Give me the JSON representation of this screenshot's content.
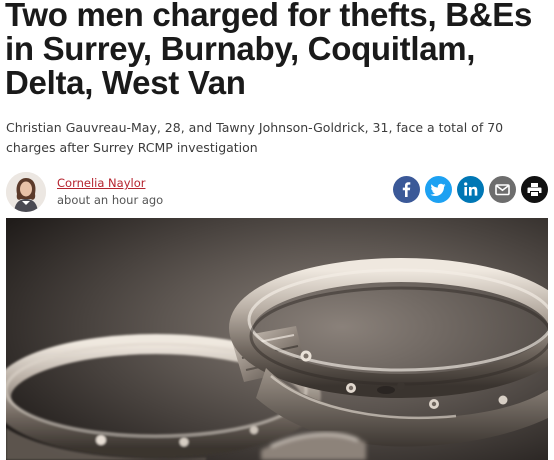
{
  "article": {
    "headline": "Two men charged for thefts, B&Es in Surrey, Burnaby, Coquitlam, Delta, West Van",
    "subhead": "Christian Gauvreau-May, 28, and Tawny Johnson-Goldrick, 31, face a total of 70 charges after Surrey RCMP investigation"
  },
  "byline": {
    "author": "Cornelia Naylor",
    "time": "about an hour ago",
    "author_color": "#b5232e"
  },
  "share": [
    {
      "name": "facebook-icon",
      "color": "#3b5998"
    },
    {
      "name": "twitter-icon",
      "color": "#1da1f2"
    },
    {
      "name": "linkedin-icon",
      "color": "#0077b5"
    },
    {
      "name": "email-icon",
      "color": "#6d6d6d"
    },
    {
      "name": "print-icon",
      "color": "#111111"
    }
  ],
  "hero": {
    "subject": "handcuffs"
  }
}
